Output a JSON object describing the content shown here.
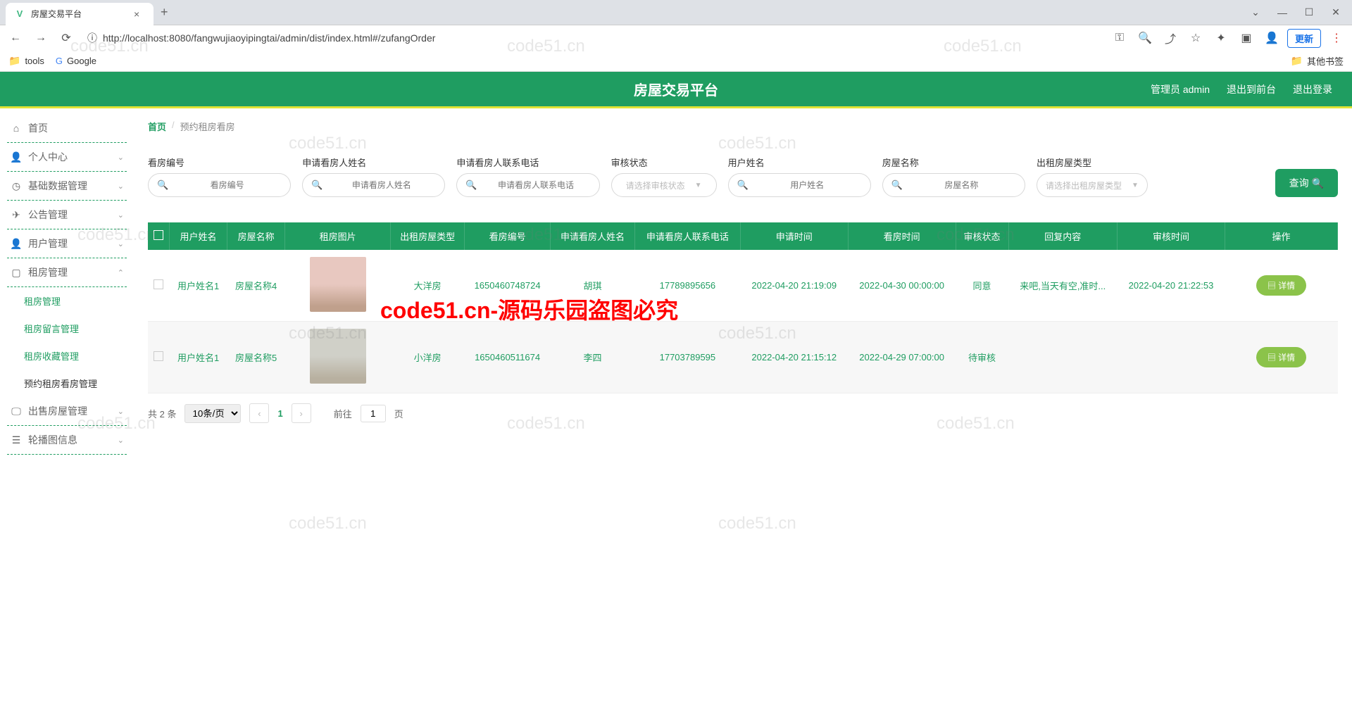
{
  "browser": {
    "tab_title": "房屋交易平台",
    "url": "http://localhost:8080/fangwujiaoyipingtai/admin/dist/index.html#/zufangOrder",
    "update_label": "更新",
    "bookmarks": {
      "tools": "tools",
      "google": "Google",
      "other": "其他书签"
    }
  },
  "header": {
    "title": "房屋交易平台",
    "user": "管理员 admin",
    "to_front": "退出到前台",
    "logout": "退出登录"
  },
  "sidebar": {
    "home": "首页",
    "personal": "个人中心",
    "basic": "基础数据管理",
    "notice": "公告管理",
    "user": "用户管理",
    "rent": "租房管理",
    "sub_rent": "租房管理",
    "sub_msg": "租房留言管理",
    "sub_fav": "租房收藏管理",
    "sub_view": "预约租房看房管理",
    "sell": "出售房屋管理",
    "carousel": "轮播图信息"
  },
  "breadcrumb": {
    "home": "首页",
    "current": "预约租房看房"
  },
  "search": {
    "f1_label": "看房编号",
    "f1_ph": "看房编号",
    "f2_label": "申请看房人姓名",
    "f2_ph": "申请看房人姓名",
    "f3_label": "申请看房人联系电话",
    "f3_ph": "申请看房人联系电话",
    "f4_label": "审核状态",
    "f4_ph": "请选择审核状态",
    "f5_label": "用户姓名",
    "f5_ph": "用户姓名",
    "f6_label": "房屋名称",
    "f6_ph": "房屋名称",
    "f7_label": "出租房屋类型",
    "f7_ph": "请选择出租房屋类型",
    "query": "查询"
  },
  "table": {
    "headers": [
      "",
      "用户姓名",
      "房屋名称",
      "租房图片",
      "出租房屋类型",
      "看房编号",
      "申请看房人姓名",
      "申请看房人联系电话",
      "申请时间",
      "看房时间",
      "审核状态",
      "回复内容",
      "审核时间",
      "操作"
    ],
    "rows": [
      {
        "user": "用户姓名1",
        "house": "房屋名称4",
        "type": "大洋房",
        "code": "1650460748724",
        "viewer": "胡琪",
        "phone": "17789895656",
        "apply_time": "2022-04-20 21:19:09",
        "view_time": "2022-04-30 00:00:00",
        "status": "同意",
        "reply": "来吧,当天有空,准时...",
        "review_time": "2022-04-20 21:22:53",
        "btn": "详情"
      },
      {
        "user": "用户姓名1",
        "house": "房屋名称5",
        "type": "小洋房",
        "code": "1650460511674",
        "viewer": "李四",
        "phone": "17703789595",
        "apply_time": "2022-04-20 21:15:12",
        "view_time": "2022-04-29 07:00:00",
        "status": "待审核",
        "reply": "",
        "review_time": "",
        "btn": "详情"
      }
    ]
  },
  "pager": {
    "total": "共 2 条",
    "page_size": "10条/页",
    "page_num": "1",
    "goto": "前往",
    "goto_val": "1",
    "page_suffix": "页"
  },
  "watermark": "code51.cn",
  "watermark_red": "code51.cn-源码乐园盗图必究"
}
